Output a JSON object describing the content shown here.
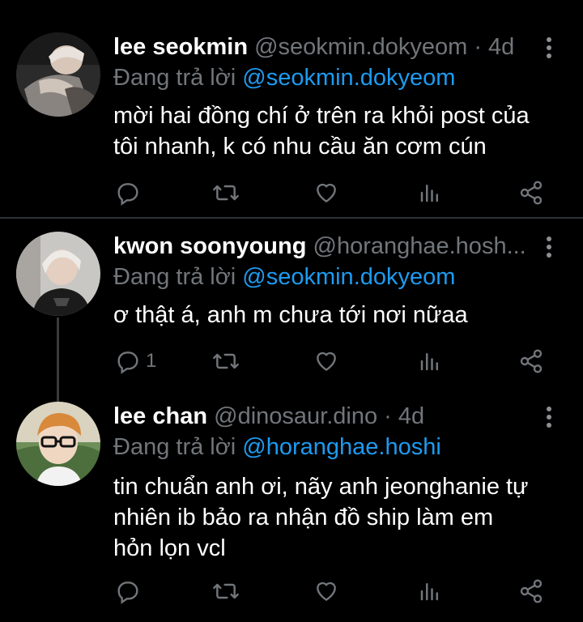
{
  "colors": {
    "background": "#000000",
    "text": "#ffffff",
    "muted": "#71767b",
    "link": "#1d9bf0"
  },
  "tweets": [
    {
      "name": "lee seokmin",
      "handle": "@seokmin.dokyeom",
      "dot": "·",
      "time": "4d",
      "replying_label": "Đang trả lời",
      "replying_to": "@seokmin.dokyeom",
      "lines": [
        "mời hai đồng chí ở trên ra khỏi post của",
        "tôi nhanh, k có nhu cầu ăn cơm cún"
      ],
      "reply_count": ""
    },
    {
      "name": "kwon soonyoung",
      "handle": "@horanghae.hosh...",
      "replying_label": "Đang trả lời",
      "replying_to": "@seokmin.dokyeom",
      "lines": [
        "ơ thật á, anh m chưa tới nơi nữaa"
      ],
      "reply_count": "1"
    },
    {
      "name": "lee chan",
      "handle": "@dinosaur.dino",
      "dot": "·",
      "time": "4d",
      "replying_label": "Đang trả lời",
      "replying_to": "@horanghae.hoshi",
      "lines": [
        "tin chuẩn anh ơi, nãy anh jeonghanie tự",
        "nhiên ib bảo ra nhận đồ ship làm em",
        "hỏn lọn vcl"
      ],
      "reply_count": ""
    }
  ],
  "icons": [
    "reply-icon",
    "retweet-icon",
    "like-icon",
    "views-icon",
    "share-icon",
    "more-icon"
  ]
}
